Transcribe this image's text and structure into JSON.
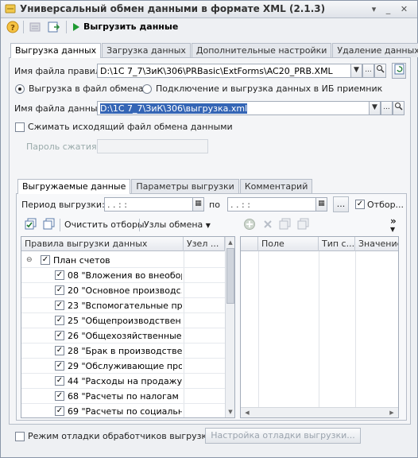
{
  "window": {
    "title": "Универсальный обмен данными в формате XML (2.1.3)"
  },
  "toolbar": {
    "export_label": "Выгрузить данные"
  },
  "main_tabs": [
    {
      "label": "Выгрузка данных",
      "active": true
    },
    {
      "label": "Загрузка данных",
      "active": false
    },
    {
      "label": "Дополнительные настройки",
      "active": false
    },
    {
      "label": "Удаление данных",
      "active": false
    }
  ],
  "rules_file": {
    "label": "Имя файла правил:",
    "value": "D:\\1C 7_7\\ЗиК\\306\\PRBasic\\ExtForms\\AC20_PRB.XML"
  },
  "mode": {
    "file_option": "Выгрузка в файл обмена",
    "db_option": "Подключение и выгрузка данных в ИБ приемник"
  },
  "data_file": {
    "label": "Имя файла данных:",
    "value": "D:\\1C 7_7\\ЗиК\\306\\выгрузка.xml"
  },
  "compress": {
    "label": "Сжимать исходящий файл обмена данными",
    "password_label": "Пароль сжатия:"
  },
  "inner_tabs": [
    {
      "label": "Выгружаемые данные",
      "active": true
    },
    {
      "label": "Параметры выгрузки",
      "active": false
    },
    {
      "label": "Комментарий",
      "active": false
    }
  ],
  "period": {
    "label": "Период выгрузки:",
    "from": "  .  .      :  :  ",
    "separator": "по",
    "to": "  .  .      :  :  ",
    "select_btn": "...",
    "filter_label": "Отбор..."
  },
  "grid_toolbar": {
    "clear_filters": "Очистить отборы",
    "exchange_nodes": "Узлы обмена",
    "more": "»"
  },
  "rules_grid": {
    "columns": [
      "Правила выгрузки данных",
      "Узел ..."
    ],
    "root": "План счетов",
    "rows": [
      "08 \"Вложения во внеобор...",
      "20 \"Основное производс...",
      "23 \"Вспомогательные пр...",
      "25 \"Общепроизводствен...",
      "26 \"Общехозяйственные ...",
      "28 \"Брак в производстве\"",
      "29 \"Обслуживающие про...",
      "44 \"Расходы на продажу\"",
      "68 \"Расчеты по налогам ...",
      "69 \"Расчеты по социальн..."
    ]
  },
  "fields_grid": {
    "columns": [
      "Поле",
      "Тип с...",
      "Значение"
    ]
  },
  "debug": {
    "label": "Режим отладки обработчиков выгрузки",
    "settings_button": "Настройка отладки выгрузки..."
  }
}
